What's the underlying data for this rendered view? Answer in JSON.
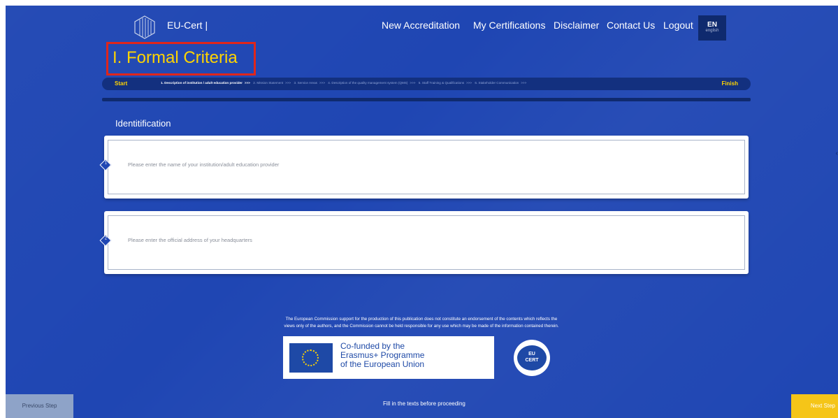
{
  "header": {
    "brand": "EU-Cert |",
    "nav": [
      "New Accreditation",
      "My Certifications",
      "Disclaimer",
      "Contact Us",
      "Logout"
    ],
    "lang_code": "EN",
    "lang_name": "english"
  },
  "page_title": "I. Formal Criteria",
  "stepper": {
    "start": "Start",
    "finish": "Finish",
    "separator": ">>>",
    "steps": [
      "1. Description of institution / adult education provider",
      "2. Mission Statement",
      "3. Service Areas",
      "4. Description of the quality management system (QMS)",
      "5. Staff Training & Qualifications",
      "6. Stakeholder Communication"
    ]
  },
  "section": {
    "label": "Identitification",
    "fields": [
      {
        "number": "1",
        "placeholder": "Please enter the name of your institution/adult education provider"
      },
      {
        "number": "2",
        "placeholder": "Please enter the official address of your headquarters"
      }
    ]
  },
  "footer": {
    "disclaimer_line1": "The European Commission support for the production of this publication does not constitute an endorsement of the contents which reflects the",
    "disclaimer_line2": "views only of the authors, and the Commission cannot be held responsible for any use which may be made of the information contained therein.",
    "erasmus_line1": "Co-funded by the",
    "erasmus_line2": "Erasmus+ Programme",
    "erasmus_line3": "of the European Union",
    "badge_top": "EU",
    "badge_bottom": "CERT"
  },
  "bottom_bar": {
    "previous": "Previous Step",
    "message": "Fill in the texts before proceeding",
    "next": "Next Step"
  },
  "colors": {
    "background": "#1f46b3",
    "accent_yellow": "#ffd400",
    "highlight_box": "#e0261b",
    "next_button": "#f5c518",
    "prev_button": "#8ea3c8"
  }
}
